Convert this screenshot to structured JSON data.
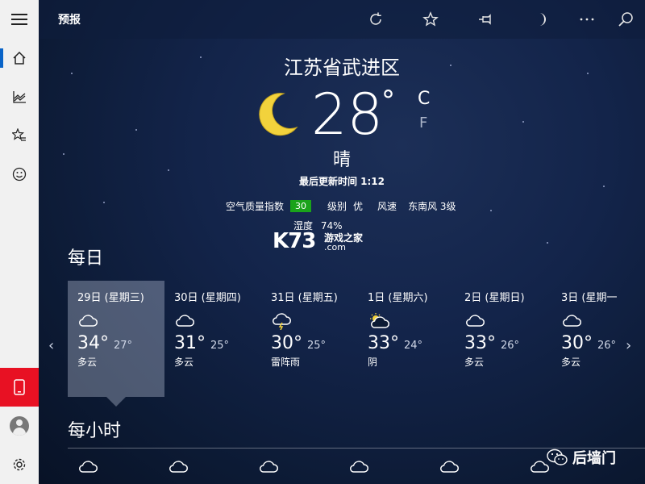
{
  "app": {
    "title": "预报"
  },
  "sidebar": {
    "items": [
      {
        "name": "menu-icon"
      },
      {
        "name": "home-icon"
      },
      {
        "name": "historical-chart-icon"
      },
      {
        "name": "favorites-icon"
      },
      {
        "name": "life-icon"
      }
    ],
    "bottom": [
      {
        "name": "device-icon",
        "accent": "#e81123"
      },
      {
        "name": "account-avatar"
      },
      {
        "name": "settings-icon"
      }
    ]
  },
  "toolbar": {
    "icons": [
      "refresh-icon",
      "favorite-star-icon",
      "pin-icon",
      "night-mode-icon",
      "more-icon",
      "search-icon"
    ]
  },
  "current": {
    "location": "江苏省武进区",
    "temperature": "28",
    "degree": "°",
    "unit_c": "C",
    "unit_f": "F",
    "condition": "晴",
    "updated": "最后更新时间 1:12",
    "aqi_label": "空气质量指数",
    "aqi_value": "30",
    "aqi_color": "#1aa31a",
    "level_label": "级别",
    "level_value": "优",
    "wind_label": "风速",
    "wind_value": "东南风 3级",
    "humidity_label": "湿度",
    "humidity_value": "74%"
  },
  "watermark": {
    "logo": "K73",
    "sub": "游戏之家",
    "domain": ".com"
  },
  "daily": {
    "title": "每日",
    "days": [
      {
        "label": "29日 (星期三)",
        "icon": "cloud-icon",
        "hi": "34°",
        "lo": "27°",
        "cond": "多云",
        "selected": true
      },
      {
        "label": "30日 (星期四)",
        "icon": "cloud-icon",
        "hi": "31°",
        "lo": "25°",
        "cond": "多云"
      },
      {
        "label": "31日 (星期五)",
        "icon": "thunder-cloud-icon",
        "hi": "30°",
        "lo": "25°",
        "cond": "雷阵雨"
      },
      {
        "label": "1日 (星期六)",
        "icon": "sun-cloud-icon",
        "hi": "33°",
        "lo": "24°",
        "cond": "阴"
      },
      {
        "label": "2日 (星期日)",
        "icon": "cloud-icon",
        "hi": "33°",
        "lo": "26°",
        "cond": "多云"
      },
      {
        "label": "3日 (星期一",
        "icon": "cloud-icon",
        "hi": "30°",
        "lo": "26°",
        "cond": "多云"
      }
    ],
    "prev": "‹",
    "next": "›"
  },
  "hourly": {
    "title": "每小时",
    "count": 6
  },
  "overlay": {
    "wechat_label": "后墙门"
  }
}
